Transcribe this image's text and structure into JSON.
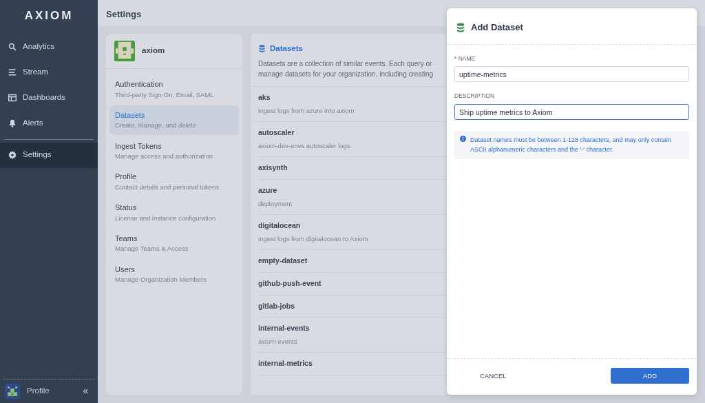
{
  "sidebar": {
    "logo": "AXIOM",
    "items": [
      {
        "label": "Analytics",
        "selected": false
      },
      {
        "label": "Stream",
        "selected": false
      },
      {
        "label": "Dashboards",
        "selected": false
      },
      {
        "label": "Alerts",
        "selected": false
      },
      {
        "label": "Settings",
        "selected": true
      }
    ],
    "profile": "Profile"
  },
  "header": {
    "title": "Settings"
  },
  "settings_nav": {
    "org": "axiom",
    "items": [
      {
        "title": "Authentication",
        "subtitle": "Third-party Sign-On, Email, SAML",
        "selected": false
      },
      {
        "title": "Datasets",
        "subtitle": "Create, manage, and delete",
        "selected": true
      },
      {
        "title": "Ingest Tokens",
        "subtitle": "Manage access and authorization",
        "selected": false
      },
      {
        "title": "Profile",
        "subtitle": "Contact details and personal tokens",
        "selected": false
      },
      {
        "title": "Status",
        "subtitle": "License and instance configuration",
        "selected": false
      },
      {
        "title": "Teams",
        "subtitle": "Manage Teams & Access",
        "selected": false
      },
      {
        "title": "Users",
        "subtitle": "Manage Organization Members",
        "selected": false
      }
    ]
  },
  "datasets_panel": {
    "title": "Datasets",
    "description": [
      "Datasets are a collection of similar events. Each query or",
      "manage datasets for your organization, including creating"
    ],
    "datasets": [
      {
        "name": "aks",
        "description": "ingest logs from azure into axiom"
      },
      {
        "name": "autoscaler",
        "description": "axiom-dev-envs autoscaler logs"
      },
      {
        "name": "axisynth"
      },
      {
        "name": "azure",
        "description": "deployment"
      },
      {
        "name": "digitalocean",
        "description": "ingest logs from digitalocean to Axiom"
      },
      {
        "name": "empty-dataset"
      },
      {
        "name": "github-push-event"
      },
      {
        "name": "gitlab-jobs"
      },
      {
        "name": "internal-events",
        "description": "axiom-events"
      },
      {
        "name": "internal-metrics"
      }
    ]
  },
  "dialog": {
    "title": "Add Dataset",
    "fields": [
      {
        "label": "* NAME",
        "value": "uptime-metrics",
        "focused": false
      },
      {
        "label": "DESCRIPTION",
        "value": "Ship uptime metrics to Axiom",
        "focused": true
      }
    ],
    "info": "Dataset names must be between 1-128 characters, and may only contain ASCII alphanumeric characters and the '-' character.",
    "cancel": "CANCEL",
    "submit": "ADD"
  }
}
